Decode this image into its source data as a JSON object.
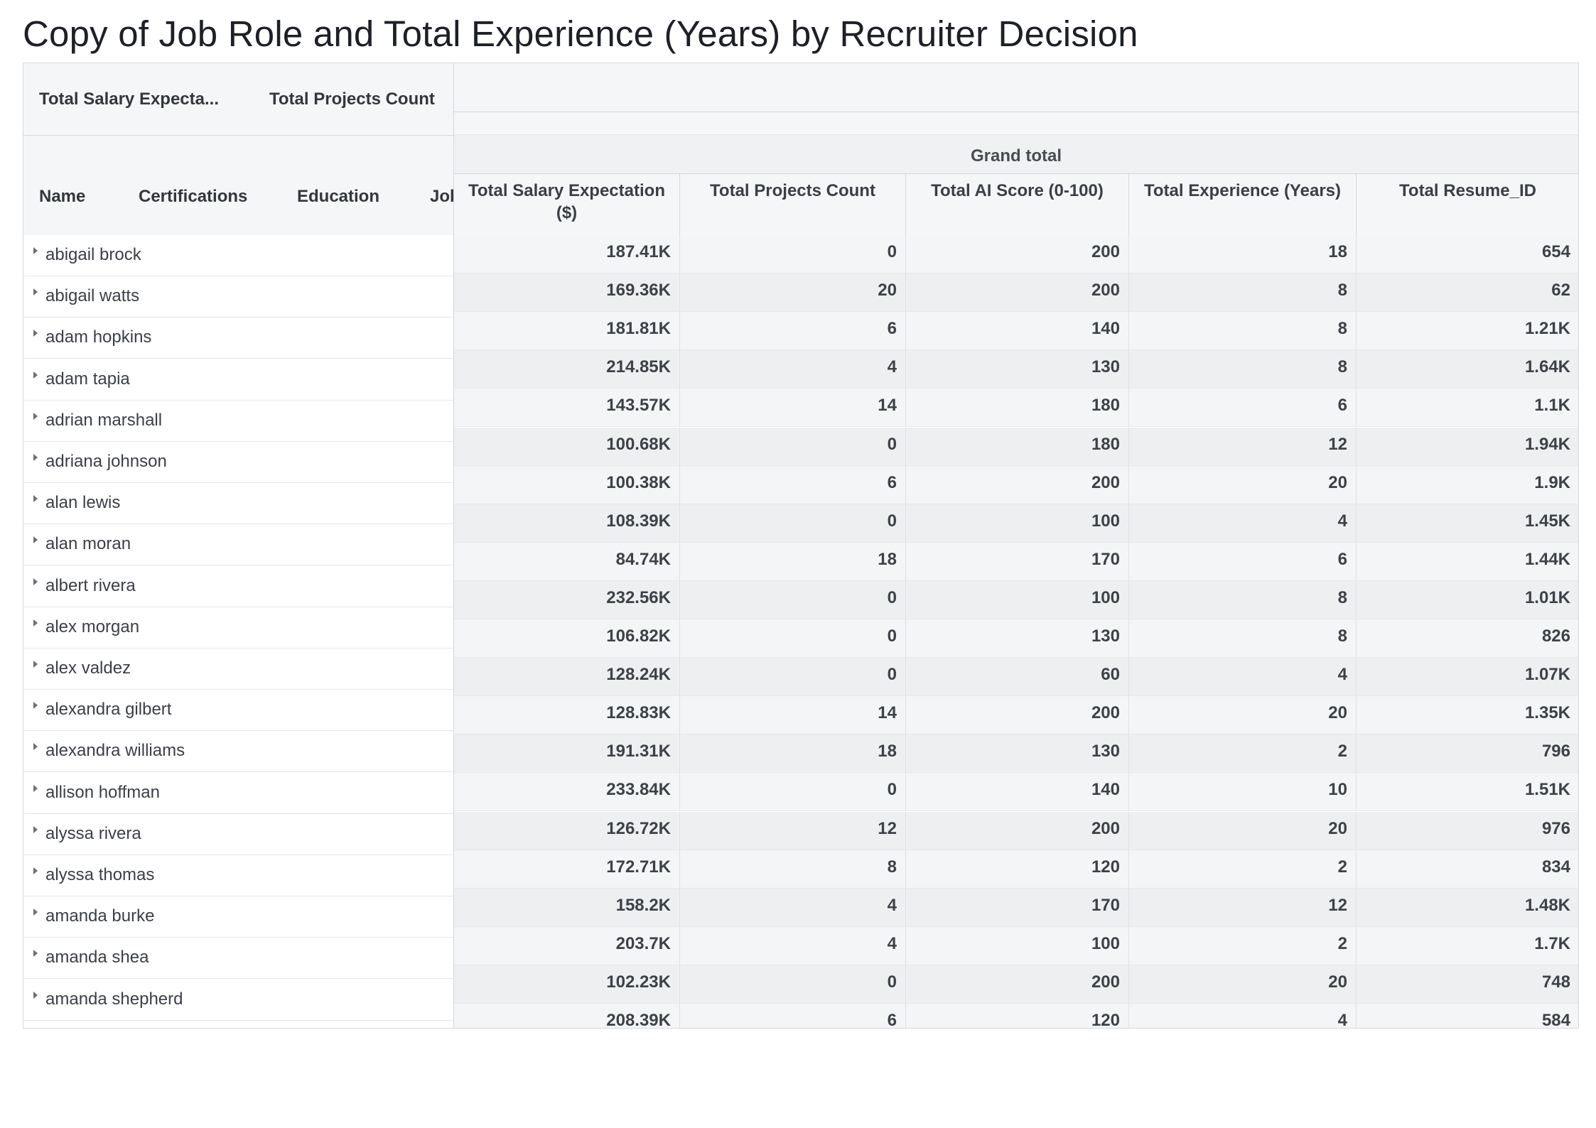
{
  "title": "Copy of Job Role and Total Experience (Years) by Recruiter Decision",
  "left_header": {
    "value_fields": [
      "Total Salary Expecta...",
      "Total Projects Count"
    ],
    "row_fields": [
      "Name",
      "Certifications",
      "Education",
      "Job Role"
    ]
  },
  "right_header": {
    "grand_total": "Grand total",
    "columns": [
      "Total Salary Expectation ($)",
      "Total Projects Count",
      "Total AI Score (0-100)",
      "Total Experience (Years)",
      "Total Resume_ID"
    ]
  },
  "names": [
    "abigail brock",
    "abigail watts",
    "adam hopkins",
    "adam tapia",
    "adrian marshall",
    "adriana johnson",
    "alan lewis",
    "alan moran",
    "albert rivera",
    "alex morgan",
    "alex valdez",
    "alexandra gilbert",
    "alexandra williams",
    "allison hoffman",
    "alyssa rivera",
    "alyssa thomas",
    "amanda burke",
    "amanda shea",
    "amanda shepherd"
  ],
  "rows": [
    [
      "187.41K",
      "0",
      "200",
      "18",
      "654"
    ],
    [
      "169.36K",
      "20",
      "200",
      "8",
      "62"
    ],
    [
      "181.81K",
      "6",
      "140",
      "8",
      "1.21K"
    ],
    [
      "214.85K",
      "4",
      "130",
      "8",
      "1.64K"
    ],
    [
      "143.57K",
      "14",
      "180",
      "6",
      "1.1K"
    ],
    [
      "100.68K",
      "0",
      "180",
      "12",
      "1.94K"
    ],
    [
      "100.38K",
      "6",
      "200",
      "20",
      "1.9K"
    ],
    [
      "108.39K",
      "0",
      "100",
      "4",
      "1.45K"
    ],
    [
      "84.74K",
      "18",
      "170",
      "6",
      "1.44K"
    ],
    [
      "232.56K",
      "0",
      "100",
      "8",
      "1.01K"
    ],
    [
      "106.82K",
      "0",
      "130",
      "8",
      "826"
    ],
    [
      "128.24K",
      "0",
      "60",
      "4",
      "1.07K"
    ],
    [
      "128.83K",
      "14",
      "200",
      "20",
      "1.35K"
    ],
    [
      "191.31K",
      "18",
      "130",
      "2",
      "796"
    ],
    [
      "233.84K",
      "0",
      "140",
      "10",
      "1.51K"
    ],
    [
      "126.72K",
      "12",
      "200",
      "20",
      "976"
    ],
    [
      "172.71K",
      "8",
      "120",
      "2",
      "834"
    ],
    [
      "158.2K",
      "4",
      "170",
      "12",
      "1.48K"
    ],
    [
      "203.7K",
      "4",
      "100",
      "2",
      "1.7K"
    ],
    [
      "102.23K",
      "0",
      "200",
      "20",
      "748"
    ],
    [
      "208.39K",
      "6",
      "120",
      "4",
      "584"
    ]
  ]
}
